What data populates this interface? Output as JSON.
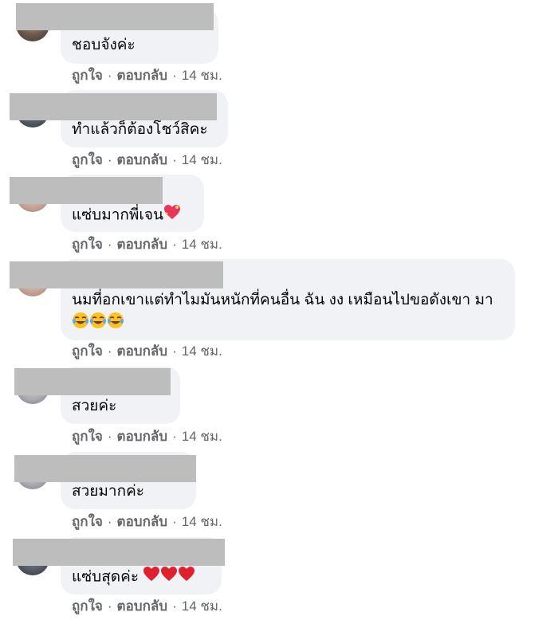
{
  "comments": [
    {
      "text": "ชอบจังค่ะ",
      "like": "ถูกใจ",
      "reply": "ตอบกลับ",
      "time": "14 ชม."
    },
    {
      "text": "ทำแล้วก็ต้องโชว์สิคะ",
      "like": "ถูกใจ",
      "reply": "ตอบกลับ",
      "time": "14 ชม."
    },
    {
      "text": "แซ่บมากพี่เจน",
      "like": "ถูกใจ",
      "reply": "ตอบกลับ",
      "time": "14 ชม.",
      "emoji": "sparkling-heart-icon"
    },
    {
      "text": "นมที่อกเขาแต่ทำไมมันหนักที่คนอื่น ฉัน งง เหมือนไปขอดังเขา มา",
      "like": "ถูกใจ",
      "reply": "ตอบกลับ",
      "time": "14 ชม.",
      "emoji": "laughing-tears-icon x3"
    },
    {
      "text": "สวยค่ะ",
      "like": "ถูกใจ",
      "reply": "ตอบกลับ",
      "time": "14 ชม."
    },
    {
      "text": "สวยมากค่ะ",
      "like": "ถูกใจ",
      "reply": "ตอบกลับ",
      "time": "14 ชม."
    },
    {
      "text": "แซ่บสุดค่ะ",
      "like": "ถูกใจ",
      "reply": "ตอบกลับ",
      "time": "14 ชม.",
      "emoji": "red-heart-icon x3"
    }
  ],
  "colors": {
    "bubble": "#f0f2f5",
    "meta": "#65676b",
    "mask": "#bdbdbd"
  }
}
